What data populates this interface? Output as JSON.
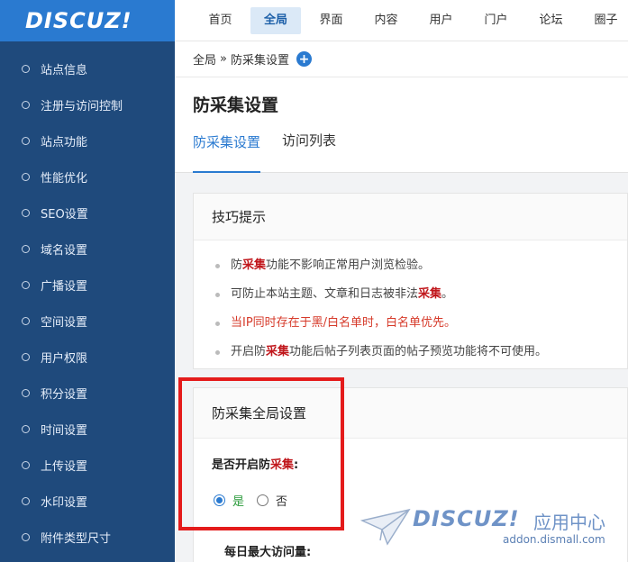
{
  "brand": {
    "logo": "DISCUZ!"
  },
  "topnav": {
    "items": [
      "首页",
      "全局",
      "界面",
      "内容",
      "用户",
      "门户",
      "论坛",
      "圈子"
    ],
    "active_index": 1
  },
  "sidebar": {
    "items": [
      "站点信息",
      "注册与访问控制",
      "站点功能",
      "性能优化",
      "SEO设置",
      "域名设置",
      "广播设置",
      "空间设置",
      "用户权限",
      "积分设置",
      "时间设置",
      "上传设置",
      "水印设置",
      "附件类型尺寸"
    ]
  },
  "breadcrumb": {
    "root": "全局",
    "sep": "»",
    "current": "防采集设置",
    "add": "+"
  },
  "page": {
    "title": "防采集设置",
    "tabs": [
      "防采集设置",
      "访问列表"
    ]
  },
  "tips": {
    "heading": "技巧提示",
    "items": [
      {
        "before": "防",
        "hl": "采集",
        "after": "功能不影响正常用户浏览检验。"
      },
      {
        "before": "可防止本站主题、文章和日志被非法",
        "hl": "采集",
        "after": "。"
      },
      {
        "before": "当IP同时存在于黑/白名单时，白名单优先。",
        "hl": "",
        "after": ""
      },
      {
        "before": "开启防",
        "hl": "采集",
        "after": "功能后帖子列表页面的帖子预览功能将不可使用。"
      }
    ]
  },
  "global_settings": {
    "heading": "防采集全局设置",
    "enable_label_before": "是否开启防",
    "enable_label_hl": "采集",
    "enable_label_after": ":",
    "options": [
      "是",
      "否"
    ],
    "selected": "是",
    "daily_max_label": "每日最大访问量:"
  },
  "watermark": {
    "logo": "DISCUZ!",
    "center": "应用中心",
    "url": "addon.dismall.com"
  },
  "colors": {
    "sidebar": "#1f4a7c",
    "logo_bg": "#2a7ad0",
    "accent": "#2a7ad0",
    "highlight_red": "#c0161b",
    "box_red": "#e41b1b"
  }
}
